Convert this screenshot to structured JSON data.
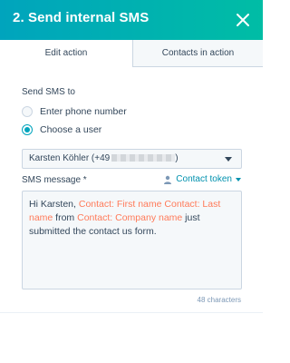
{
  "header": {
    "title": "2. Send internal SMS"
  },
  "tabs": [
    {
      "label": "Edit action",
      "active": true
    },
    {
      "label": "Contacts in action",
      "active": false
    }
  ],
  "send_to": {
    "label": "Send SMS to",
    "options": [
      {
        "label": "Enter phone number",
        "selected": false
      },
      {
        "label": "Choose a user",
        "selected": true
      }
    ]
  },
  "user_select": {
    "value": "Karsten Köhler (+49",
    "value_suffix": ")"
  },
  "message": {
    "label": "SMS message *",
    "token_link": "Contact token",
    "text_parts": [
      {
        "text": "Hi Karsten, ",
        "token": false
      },
      {
        "text": "Contact: First name",
        "token": true
      },
      {
        "text": " ",
        "token": false
      },
      {
        "text": "Contact: Last name",
        "token": true
      },
      {
        "text": " from ",
        "token": false
      },
      {
        "text": "Contact: Company name",
        "token": true
      },
      {
        "text": " just submitted the contact us form.",
        "token": false
      }
    ],
    "char_count": "48 characters"
  },
  "colors": {
    "accent": "#00a4bd",
    "token": "#ff7a59",
    "link": "#0091ae"
  }
}
